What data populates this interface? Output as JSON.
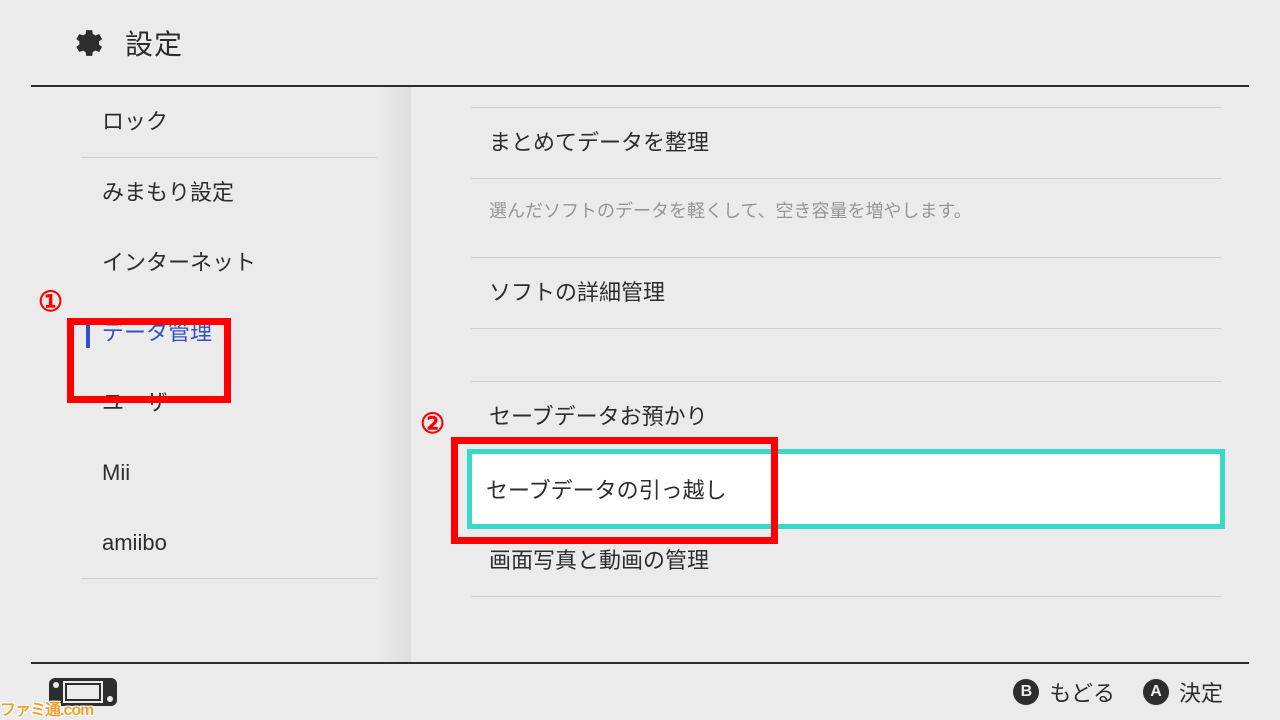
{
  "header": {
    "title": "設定"
  },
  "sidebar": {
    "items": [
      {
        "label": "ロック",
        "selected": false,
        "dividerAfter": true
      },
      {
        "label": "みまもり設定",
        "selected": false
      },
      {
        "label": "インターネット",
        "selected": false
      },
      {
        "label": "データ管理",
        "selected": true
      },
      {
        "label": "ユーザー",
        "selected": false
      },
      {
        "label": "Mii",
        "selected": false
      },
      {
        "label": "amiibo",
        "selected": false,
        "dividerAfter": true
      }
    ]
  },
  "content": {
    "rows": [
      {
        "kind": "row",
        "label": "まとめてデータを整理"
      },
      {
        "kind": "desc",
        "label": "選んだソフトのデータを軽くして、空き容量を増やします。"
      },
      {
        "kind": "row",
        "label": "ソフトの詳細管理"
      },
      {
        "kind": "spacer"
      },
      {
        "kind": "row",
        "label": "セーブデータお預かり"
      },
      {
        "kind": "selected",
        "label": "セーブデータの引っ越し"
      },
      {
        "kind": "row",
        "label": "画面写真と動画の管理"
      }
    ]
  },
  "footer": {
    "b": {
      "glyph": "B",
      "label": "もどる"
    },
    "a": {
      "glyph": "A",
      "label": "決定"
    }
  },
  "annotations": {
    "num1": "①",
    "num2": "②"
  },
  "watermark": "ファミ通.com"
}
